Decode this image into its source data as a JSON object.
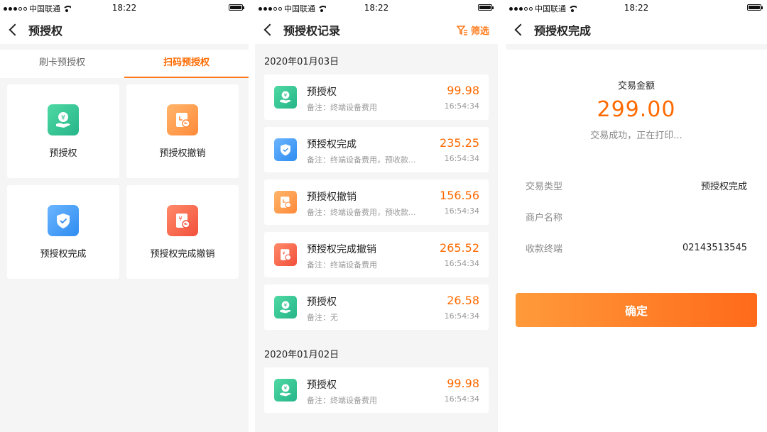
{
  "status": {
    "carrier": "中国联通",
    "time": "18:22"
  },
  "screen1": {
    "title": "预授权",
    "tabs": [
      {
        "label": "刷卡预授权",
        "active": false
      },
      {
        "label": "扫码预授权",
        "active": true
      }
    ],
    "cards": [
      {
        "label": "预授权",
        "icon": "yuan-hand-icon",
        "color": "green"
      },
      {
        "label": "预授权撤销",
        "icon": "receipt-undo-icon",
        "color": "orange"
      },
      {
        "label": "预授权完成",
        "icon": "shield-check-icon",
        "color": "blue"
      },
      {
        "label": "预授权完成撤销",
        "icon": "yuan-doc-undo-icon",
        "color": "red"
      }
    ]
  },
  "screen2": {
    "title": "预授权记录",
    "filter_label": "筛选",
    "groups": [
      {
        "date": "2020年01月03日",
        "records": [
          {
            "name": "预授权",
            "note": "备注：终端设备费用",
            "amount": "99.98",
            "time": "16:54:34"
          },
          {
            "name": "预授权完成",
            "note": "备注：终端设备费用，预收款...",
            "amount": "235.25",
            "time": "16:54:34"
          },
          {
            "name": "预授权撤销",
            "note": "备注：终端设备费用，预收款...",
            "amount": "156.56",
            "time": "16:54:34"
          },
          {
            "name": "预授权完成撤销",
            "note": "备注：终端设备费用",
            "amount": "265.52",
            "time": "16:54:34"
          },
          {
            "name": "预授权",
            "note": "备注：无",
            "amount": "26.58",
            "time": "16:54:34"
          }
        ]
      },
      {
        "date": "2020年01月02日",
        "records": [
          {
            "name": "预授权",
            "note": "备注：终端设备费用",
            "amount": "99.98",
            "time": "16:54:34"
          }
        ]
      }
    ]
  },
  "screen3": {
    "title": "预授权完成",
    "amount_label": "交易金额",
    "amount": "299.00",
    "message": "交易成功，正在打印...",
    "rows": [
      {
        "key": "交易类型",
        "value": "预授权完成"
      },
      {
        "key": "商户名称",
        "value": ""
      },
      {
        "key": "收款终端",
        "value": "02143513545"
      }
    ],
    "confirm_label": "确定"
  },
  "colors": {
    "accent": "#ff6a00",
    "green": "#2fc08f",
    "orange": "#ff8a3a",
    "blue": "#2e8cf0",
    "red": "#f2503b"
  }
}
